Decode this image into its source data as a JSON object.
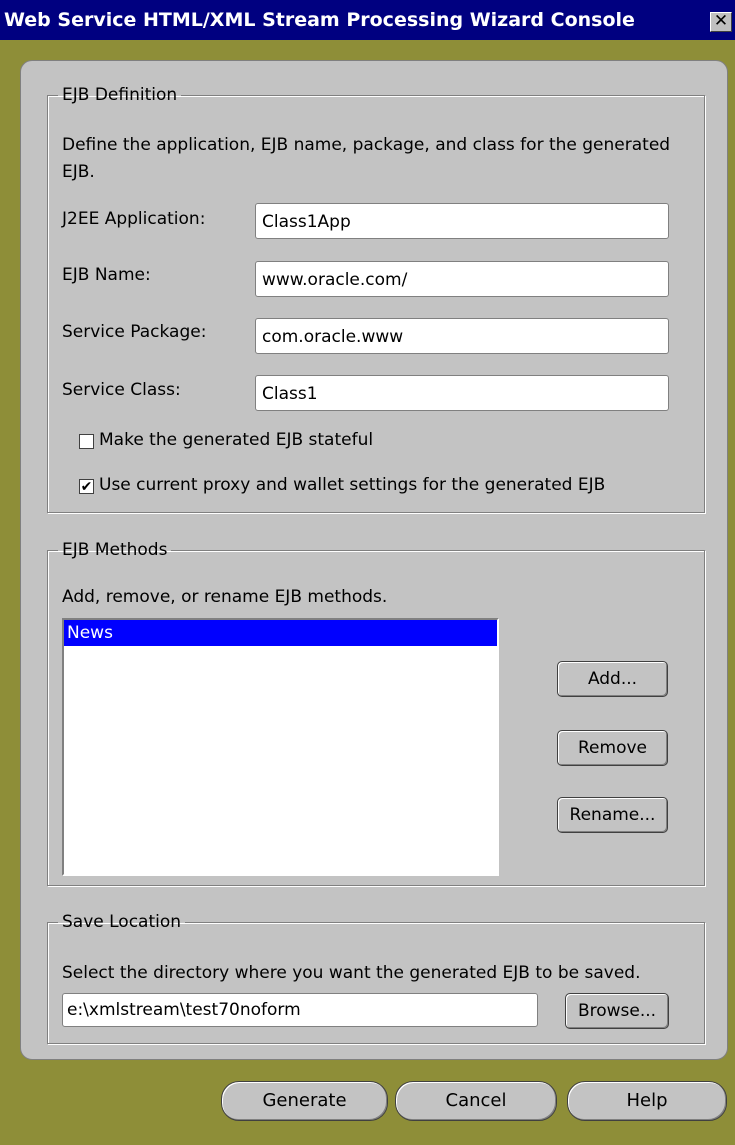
{
  "window": {
    "title": "Web Service HTML/XML Stream Processing Wizard Console",
    "close_glyph": "✕"
  },
  "ejb_definition": {
    "legend": "EJB Definition",
    "description": "Define the application, EJB name, package, and class for the generated EJB.",
    "fields": [
      {
        "label": "J2EE Application:",
        "value": "Class1App"
      },
      {
        "label": "EJB Name:",
        "value": "www.oracle.com/"
      },
      {
        "label": "Service Package:",
        "value": "com.oracle.www"
      },
      {
        "label": "Service Class:",
        "value": "Class1"
      }
    ],
    "stateful": {
      "label": "Make the generated EJB stateful",
      "checked": false
    },
    "proxy": {
      "label": "Use current proxy and wallet settings for the generated EJB",
      "checked": true
    }
  },
  "ejb_methods": {
    "legend": "EJB Methods",
    "description": "Add, remove, or rename EJB methods.",
    "items": [
      {
        "label": "News",
        "selected": true
      }
    ],
    "buttons": {
      "add": "Add...",
      "remove": "Remove",
      "rename": "Rename..."
    }
  },
  "save_location": {
    "legend": "Save Location",
    "description": "Select the directory where you want the generated EJB to be saved.",
    "path": "e:\\xmlstream\\test70noform",
    "browse": "Browse..."
  },
  "footer": {
    "generate": "Generate",
    "cancel": "Cancel",
    "help": "Help"
  },
  "colors": {
    "titlebar": "#000080",
    "frame": "#8e8e38",
    "panel": "#c3c3c3",
    "selection": "#0000ff"
  }
}
